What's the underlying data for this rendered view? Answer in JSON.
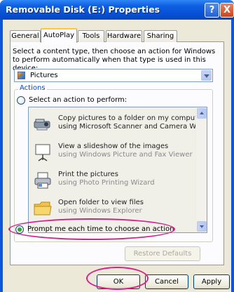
{
  "window": {
    "title": "Removable Disk (E:) Properties"
  },
  "titlebar": {
    "help_label": "?",
    "close_label": "X"
  },
  "tabs": [
    {
      "label": "General"
    },
    {
      "label": "AutoPlay"
    },
    {
      "label": "Tools"
    },
    {
      "label": "Hardware"
    },
    {
      "label": "Sharing"
    }
  ],
  "content": {
    "description": "Select a content type, then choose an action for Windows to perform automatically when that type is used in this device:",
    "content_type": {
      "selected": "Pictures",
      "icon": "pictures-icon"
    },
    "actions_group_label": "Actions",
    "select_action_label": "Select an action to perform:",
    "actions": [
      {
        "line1": "Copy pictures to a folder on my computer",
        "line2": "using Microsoft Scanner and Camera Wizard",
        "icon": "scanner-camera-icon"
      },
      {
        "line1": "View a slideshow of the images",
        "line2": "using Windows Picture and Fax Viewer",
        "icon": "projector-screen-icon"
      },
      {
        "line1": "Print the pictures",
        "line2": "using Photo Printing Wizard",
        "icon": "printer-icon"
      },
      {
        "line1": "Open folder to view files",
        "line2": "using Windows Explorer",
        "icon": "folder-icon"
      }
    ],
    "prompt_label": "Prompt me each time to choose an action",
    "restore_defaults_label": "Restore Defaults"
  },
  "buttons": {
    "ok": "OK",
    "cancel": "Cancel",
    "apply": "Apply"
  },
  "colors": {
    "titlebar": "#0651d6",
    "group_label": "#0046d5",
    "highlight": "#d6228a",
    "tab_accent": "#ffc83c"
  }
}
